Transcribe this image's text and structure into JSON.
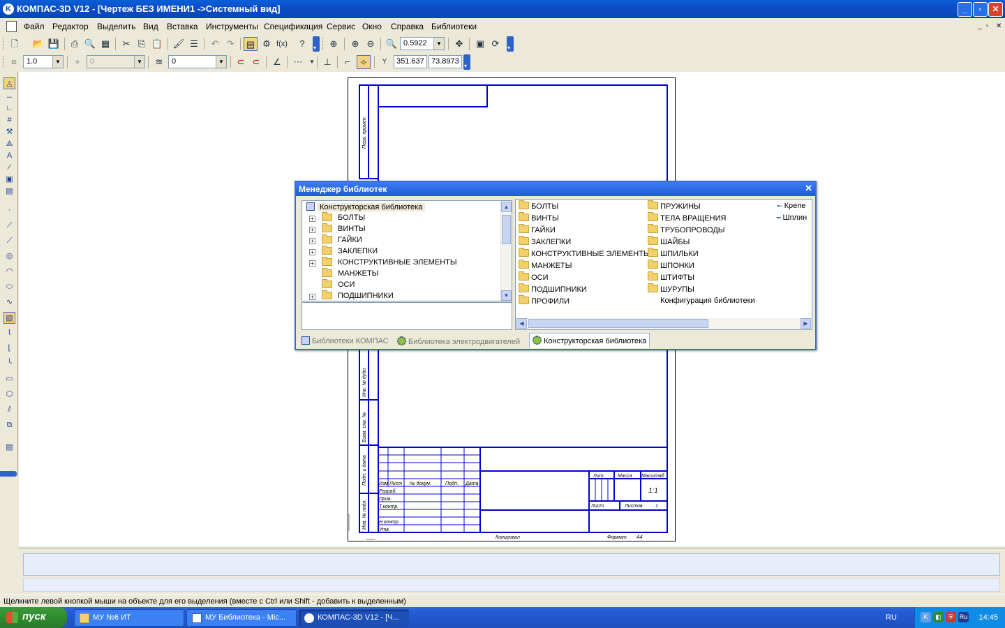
{
  "window": {
    "title": "КОМПАС-3D V12 - [Чертеж БЕЗ ИМЕНИ1 ->Системный вид]",
    "app_icon_letter": "K",
    "minimize": "_",
    "maximize": "▫",
    "close": "✕"
  },
  "menu": {
    "items": [
      "Файл",
      "Редактор",
      "Выделить",
      "Вид",
      "Вставка",
      "Инструменты",
      "Спецификация",
      "Сервис",
      "Окно",
      "Справка",
      "Библиотеки"
    ],
    "doc_controls": [
      "_",
      "▫",
      "✕"
    ]
  },
  "toolbar1": {
    "zoom_value": "0.5922"
  },
  "toolbar2": {
    "step_value": "1.0",
    "angle_value": "0",
    "layer_value": "0",
    "coord_x": "351.637",
    "coord_y": "73.8973"
  },
  "drawing": {
    "stamp_labels": {
      "perv_primen": "Перв. примен.",
      "inv_dubl": "Инв. № дубл.",
      "vzam_inv": "Взам. инв. №",
      "podp_data": "Подп. и дата",
      "inv_podl": "Инв. № подл.",
      "izm": "Изм",
      "list": "Лист",
      "n_dokum": "№ докум.",
      "podp": "Подп.",
      "data": "Дата",
      "razrab": "Разраб.",
      "prov": "Пров.",
      "t_kontr": "Т.контр.",
      "n_kontr": "Н.контр.",
      "utv": "Утв.",
      "lit": "Лит.",
      "massa": "Масса",
      "masshtab": "Масштаб",
      "scale_value": "1:1",
      "list2": "Лист",
      "listov": "Листов",
      "listov_value": "1",
      "kopiroval": "Копировал",
      "format": "Формат",
      "format_value": "А4"
    }
  },
  "library_manager": {
    "title": "Менеджер библиотек",
    "tree_root": "Конструкторская библиотека",
    "tree_items": [
      {
        "label": "БОЛТЫ",
        "expandable": true
      },
      {
        "label": "ВИНТЫ",
        "expandable": true
      },
      {
        "label": "ГАЙКИ",
        "expandable": true
      },
      {
        "label": "ЗАКЛЕПКИ",
        "expandable": true
      },
      {
        "label": "КОНСТРУКТИВНЫЕ ЭЛЕМЕНТЫ",
        "expandable": true
      },
      {
        "label": "МАНЖЕТЫ",
        "expandable": false
      },
      {
        "label": "ОСИ",
        "expandable": false
      },
      {
        "label": "ПОДШИПНИКИ",
        "expandable": true
      }
    ],
    "list_col1": [
      "БОЛТЫ",
      "ВИНТЫ",
      "ГАЙКИ",
      "ЗАКЛЕПКИ",
      "КОНСТРУКТИВНЫЕ ЭЛЕМЕНТЫ",
      "МАНЖЕТЫ",
      "ОСИ",
      "ПОДШИПНИКИ",
      "ПРОФИЛИ"
    ],
    "list_col2": [
      "ПРУЖИНЫ",
      "ТЕЛА ВРАЩЕНИЯ",
      "ТРУБОПРОВОДЫ",
      "ШАЙБЫ",
      "ШПИЛЬКИ",
      "ШПОНКИ",
      "ШТИФТЫ",
      "ШУРУПЫ"
    ],
    "list_col2_extra": "Конфигурация библиотеки",
    "list_col3": [
      "Крепе",
      "Шплин"
    ],
    "tabs": [
      "Библиотеки КОМПАС",
      "Библиотека электродвигателей",
      "Конструкторская библиотека"
    ],
    "active_tab": 2
  },
  "status": {
    "hint": "Щелкните левой кнопкой мыши на объекте для его выделения (вместе с Ctrl или Shift - добавить к выделенным)"
  },
  "taskbar": {
    "start": "пуск",
    "tasks": [
      "МУ №6 ИТ",
      "МУ Библиотека - Mic...",
      "КОМПАС-3D V12 - [Ч..."
    ],
    "active_task": 2,
    "lang": "RU",
    "tray_lang": "Ru",
    "clock": "14:45"
  },
  "colors": {
    "frame_blue": "#0000d0",
    "xp_blue": "#245dd7",
    "start_green": "#2e8b2e"
  }
}
